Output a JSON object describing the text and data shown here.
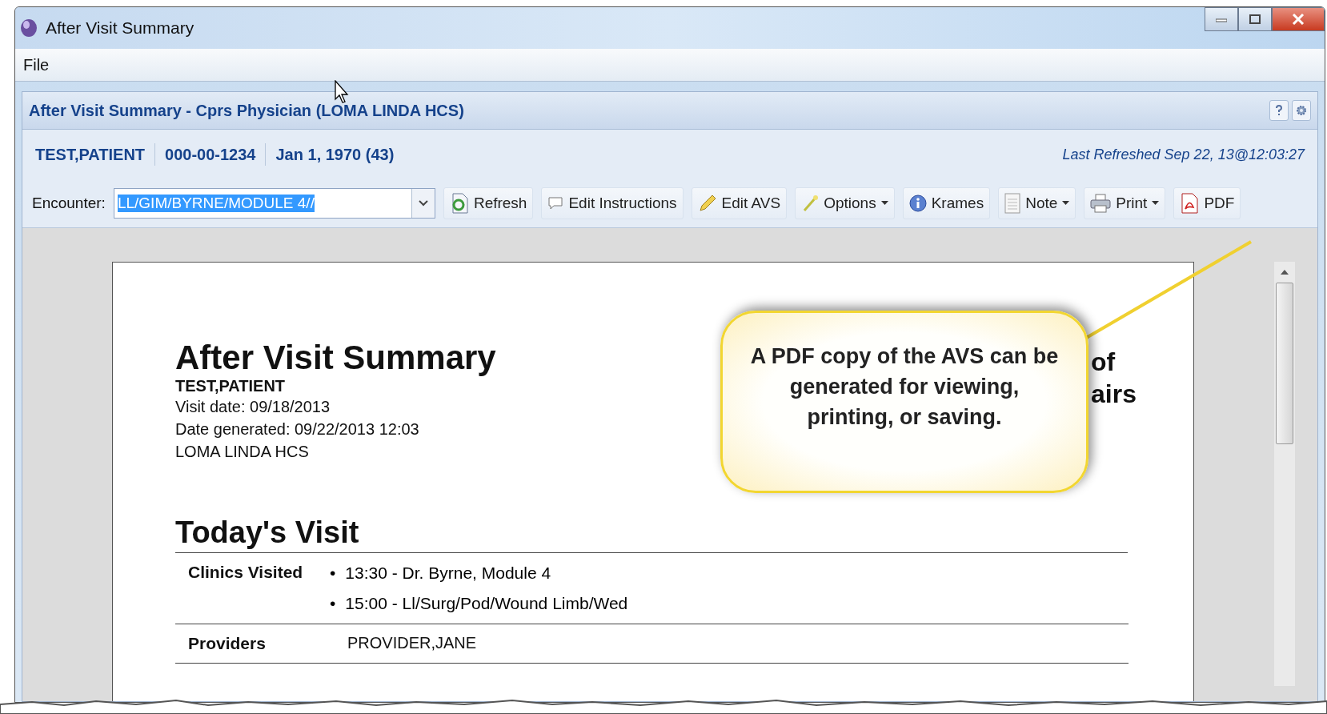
{
  "window": {
    "title": "After Visit Summary"
  },
  "menu": [
    {
      "label": "File"
    }
  ],
  "panel": {
    "title": "After Visit Summary - Cprs Physician (LOMA LINDA HCS)"
  },
  "patient": {
    "name": "TEST,PATIENT",
    "ssn": "000-00-1234",
    "dob": "Jan 1, 1970 (43)",
    "last_refreshed": "Last Refreshed Sep 22, 13@12:03:27"
  },
  "encounter": {
    "label": "Encounter:",
    "value": "LL/GIM/BYRNE/MODULE 4//"
  },
  "toolbar": [
    {
      "label": "Refresh",
      "dropdown": false
    },
    {
      "label": "Edit Instructions",
      "dropdown": false
    },
    {
      "label": "Edit AVS",
      "dropdown": false
    },
    {
      "label": "Options",
      "dropdown": true
    },
    {
      "label": "Krames",
      "dropdown": false
    },
    {
      "label": "Note",
      "dropdown": true
    },
    {
      "label": "Print",
      "dropdown": true
    },
    {
      "label": "PDF",
      "dropdown": false
    }
  ],
  "document": {
    "title": "After Visit Summary",
    "patient": "TEST,PATIENT",
    "visit_date": "Visit date: 09/18/2013",
    "date_generated": "Date generated: 09/22/2013 12:03",
    "facility": "LOMA LINDA HCS",
    "side_fragments": [
      "of",
      "airs"
    ],
    "section": "Today's Visit",
    "rows": [
      {
        "label": "Clinics Visited",
        "marker": "•",
        "items": [
          "13:30 - Dr. Byrne, Module 4",
          "15:00 - Ll/Surg/Pod/Wound Limb/Wed"
        ]
      },
      {
        "label": "Providers",
        "value": "PROVIDER,JANE"
      }
    ]
  },
  "callout": {
    "text": "A PDF copy of the AVS can be generated for viewing, printing, or saving."
  }
}
